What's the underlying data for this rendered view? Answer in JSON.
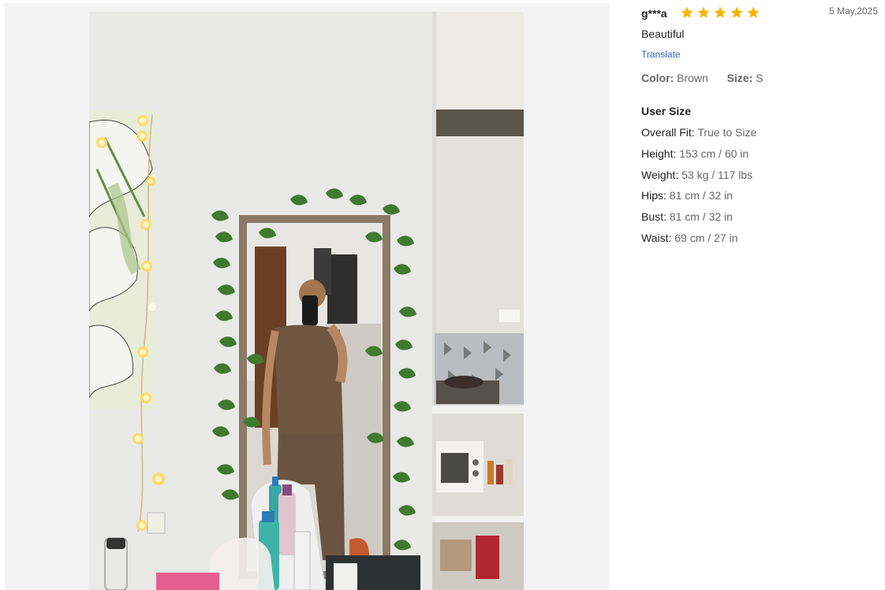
{
  "review": {
    "username": "g***a",
    "rating": 5,
    "rating_max": 5,
    "date": "5 May,2025",
    "comment": "Beautiful",
    "translate_label": "Translate",
    "color_label": "Color:",
    "color_value": "Brown",
    "size_label": "Size:",
    "size_value": "S"
  },
  "user_size": {
    "title": "User Size",
    "items": [
      {
        "label": "Overall Fit:",
        "value": "True to Size"
      },
      {
        "label": "Height:",
        "value": "153 cm / 60 in"
      },
      {
        "label": "Weight:",
        "value": "53 kg / 117 lbs"
      },
      {
        "label": "Hips:",
        "value": "81 cm / 32 in"
      },
      {
        "label": "Bust:",
        "value": "81 cm / 32 in"
      },
      {
        "label": "Waist:",
        "value": "69 cm / 27 in"
      }
    ]
  },
  "colors": {
    "star": "#f7b500",
    "link": "#2d68a8",
    "muted": "#666666"
  },
  "icons": {
    "star": "star-icon"
  }
}
